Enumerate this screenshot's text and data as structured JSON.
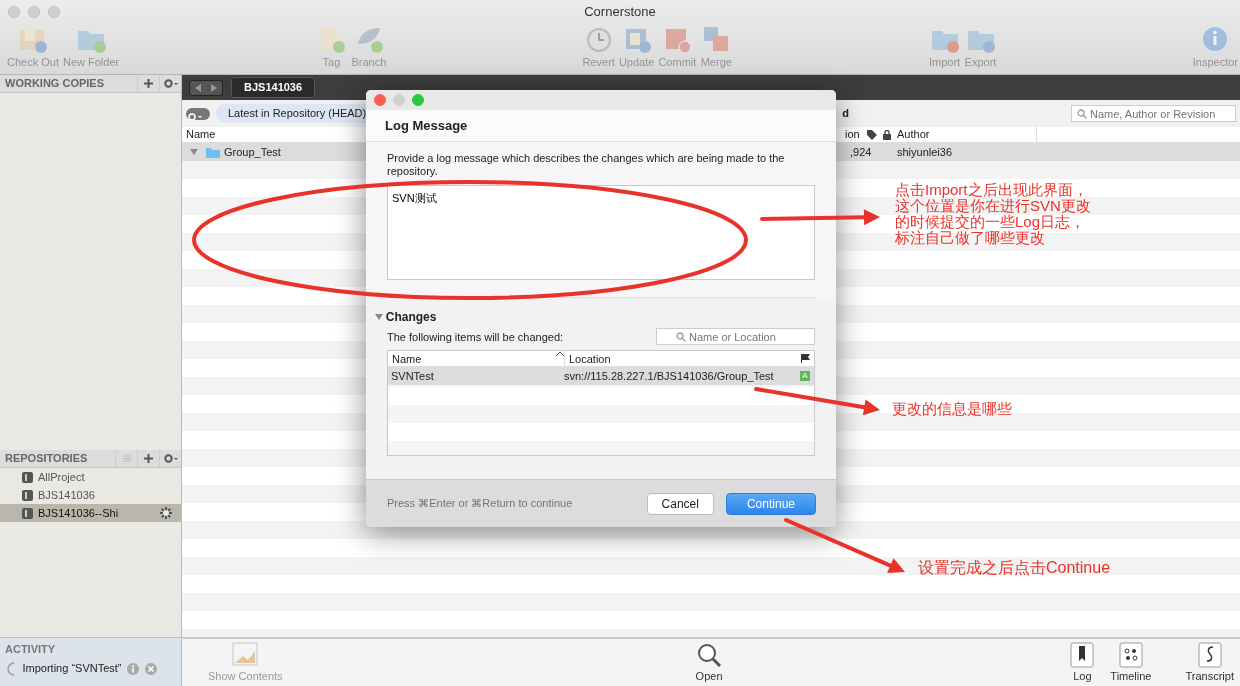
{
  "window": {
    "title": "Cornerstone"
  },
  "toolbar": [
    {
      "label": "Check Out",
      "disabled": true
    },
    {
      "label": "New Folder",
      "disabled": true
    },
    {
      "label": "Tag",
      "disabled": true
    },
    {
      "label": "Branch",
      "disabled": true
    },
    {
      "label": "Revert",
      "disabled": true
    },
    {
      "label": "Update",
      "disabled": true
    },
    {
      "label": "Commit",
      "disabled": true
    },
    {
      "label": "Merge",
      "disabled": true
    },
    {
      "label": "Import",
      "disabled": true
    },
    {
      "label": "Export",
      "disabled": true
    },
    {
      "label": "Inspector",
      "disabled": true
    }
  ],
  "sidebar": {
    "working_copies": {
      "title": "WORKING COPIES"
    },
    "repositories": {
      "title": "REPOSITORIES",
      "items": [
        {
          "label": "AllProject",
          "selected": false,
          "busy": false
        },
        {
          "label": "BJS141036",
          "selected": false,
          "busy": false
        },
        {
          "label": "BJS141036--Shi",
          "selected": true,
          "busy": true
        }
      ]
    },
    "activity": {
      "title": "ACTIVITY",
      "task": "Importing “SVNTest”"
    }
  },
  "browser": {
    "tab": "BJS141036",
    "revision_filter": "Latest in Repository (HEAD)",
    "filter_text_cut": "d",
    "search": {
      "placeholder": "Name, Author or Revision"
    },
    "columns": [
      "Name",
      "ion",
      "Author"
    ],
    "rows": [
      {
        "name": "Group_Test",
        "revision": ",924",
        "author": "shiyunlei36",
        "expanded": true,
        "selected": true
      }
    ]
  },
  "bottom_bar": {
    "left": [
      {
        "label": "Show Contents",
        "disabled": true
      },
      {
        "label": "Open",
        "disabled": false
      }
    ],
    "right": [
      {
        "label": "Log"
      },
      {
        "label": "Timeline"
      },
      {
        "label": "Transcript"
      }
    ]
  },
  "dialog": {
    "title": "Log Message",
    "prompt": "Provide a log message which describes the changes which are being made to the repository.",
    "message": "SVN测试",
    "changes": {
      "title": "Changes",
      "expanded": true,
      "subtitle": "The following items will be changed:",
      "search": {
        "placeholder": "Name or Location"
      },
      "columns": [
        "Name",
        "Location"
      ],
      "rows": [
        {
          "name": "SVNTest",
          "location": "svn://115.28.227.1/BJS141036/Group_Test",
          "status": "A",
          "selected": true
        }
      ]
    },
    "hint": "Press ⌘Enter or ⌘Return to continue",
    "buttons": [
      {
        "label": "Cancel",
        "primary": false
      },
      {
        "label": "Continue",
        "primary": true
      }
    ]
  },
  "annotations": [
    {
      "lines": [
        "点击Import之后出现此界面，",
        "这个位置是你在进行SVN更改",
        "的时候提交的一些Log日志，",
        "标注自己做了哪些更改"
      ]
    },
    {
      "lines": [
        "更改的信息是哪些"
      ]
    },
    {
      "lines": [
        "设置完成之后点击Continue"
      ]
    }
  ]
}
